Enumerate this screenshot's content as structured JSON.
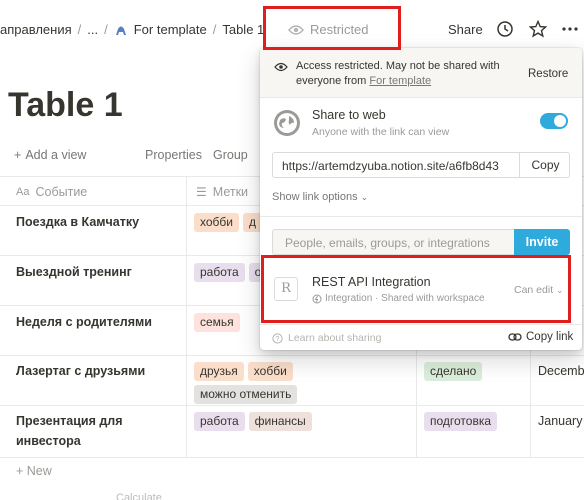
{
  "breadcrumb": {
    "parent": "аправления",
    "ellipsis": "...",
    "template": "For template",
    "current": "Table 1"
  },
  "header": {
    "restricted_label": "Restricted",
    "share_label": "Share",
    "icons": [
      "clock-icon",
      "star-icon",
      "more-icon"
    ]
  },
  "page": {
    "title": "Table 1",
    "add_view": "Add a view",
    "properties": "Properties",
    "group": "Group"
  },
  "table": {
    "columns": [
      "Событие",
      "Метки"
    ],
    "rows": [
      {
        "name": "Поездка в Камчатку",
        "tags": [
          "хобби",
          "д"
        ]
      },
      {
        "name": "Выездной тренинг",
        "tags": [
          "работа",
          "о"
        ]
      },
      {
        "name": "Неделя с родителями",
        "tags": [
          "семья"
        ]
      },
      {
        "name": "Лазертаг с друзьями",
        "tags": [
          "друзья",
          "хобби",
          "можно отменить"
        ],
        "status": "сделано",
        "date": "Decemb"
      },
      {
        "name": "Презентация для инвестора",
        "tags": [
          "работа",
          "финансы"
        ],
        "status": "подготовка",
        "date": "January"
      }
    ],
    "new_label": "New",
    "calculate_label": "Calculate"
  },
  "tag_colors": {
    "хобби": "#fadec9",
    "д": "#fadec9",
    "работа": "#e8deee",
    "о": "#e8deee",
    "семья": "#ffe2dd",
    "друзья": "#fadec9",
    "можно отменить": "#e3e2e0",
    "финансы": "#eee0da",
    "сделано": "#dbeddb",
    "подготовка": "#e8deee"
  },
  "share_popup": {
    "warning_text": "Access restricted. May not be shared with everyone from",
    "warning_link": "For template",
    "restore_label": "Restore",
    "share_web_title": "Share to web",
    "share_web_sub": "Anyone with the link can view",
    "share_web_enabled": true,
    "url": "https://artemdzyuba.notion.site/a6fb8d43",
    "copy_label": "Copy",
    "link_options": "Show link options",
    "invite_placeholder": "People, emails, groups, or integrations",
    "invite_label": "Invite",
    "integration_title": "REST API Integration",
    "integration_sub": "Integration · Shared with workspace",
    "integration_icon_letter": "R",
    "permission": "Can edit",
    "learn_label": "Learn about sharing",
    "copy_link_label": "Copy link"
  },
  "colors": {
    "accent": "#2eaadc",
    "highlight_box": "#e01e1e"
  }
}
